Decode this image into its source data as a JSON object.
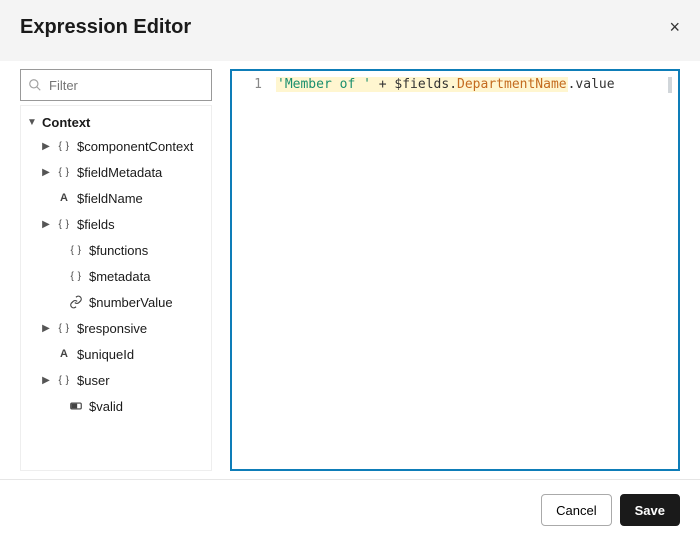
{
  "header": {
    "title": "Expression Editor",
    "close_label": "×"
  },
  "filter": {
    "placeholder": "Filter",
    "value": ""
  },
  "tree": {
    "root_label": "Context",
    "items": [
      {
        "label": "$componentContext",
        "icon": "braces",
        "expandable": true
      },
      {
        "label": "$fieldMetadata",
        "icon": "braces",
        "expandable": true
      },
      {
        "label": "$fieldName",
        "icon": "astr",
        "expandable": false
      },
      {
        "label": "$fields",
        "icon": "braces",
        "expandable": true
      },
      {
        "label": "$functions",
        "icon": "braces",
        "expandable": false,
        "depth": 2
      },
      {
        "label": "$metadata",
        "icon": "braces",
        "expandable": false,
        "depth": 2
      },
      {
        "label": "$numberValue",
        "icon": "link",
        "expandable": false,
        "depth": 2
      },
      {
        "label": "$responsive",
        "icon": "braces",
        "expandable": true
      },
      {
        "label": "$uniqueId",
        "icon": "astr",
        "expandable": false
      },
      {
        "label": "$user",
        "icon": "braces",
        "expandable": true
      },
      {
        "label": "$valid",
        "icon": "bool",
        "expandable": false,
        "depth": 2
      }
    ]
  },
  "editor": {
    "line_number": "1",
    "tokens": {
      "string": "'Member of '",
      "op": " + ",
      "var": "$fields.",
      "prop": "DepartmentName",
      "tail": ".value"
    }
  },
  "footer": {
    "cancel_label": "Cancel",
    "save_label": "Save"
  }
}
